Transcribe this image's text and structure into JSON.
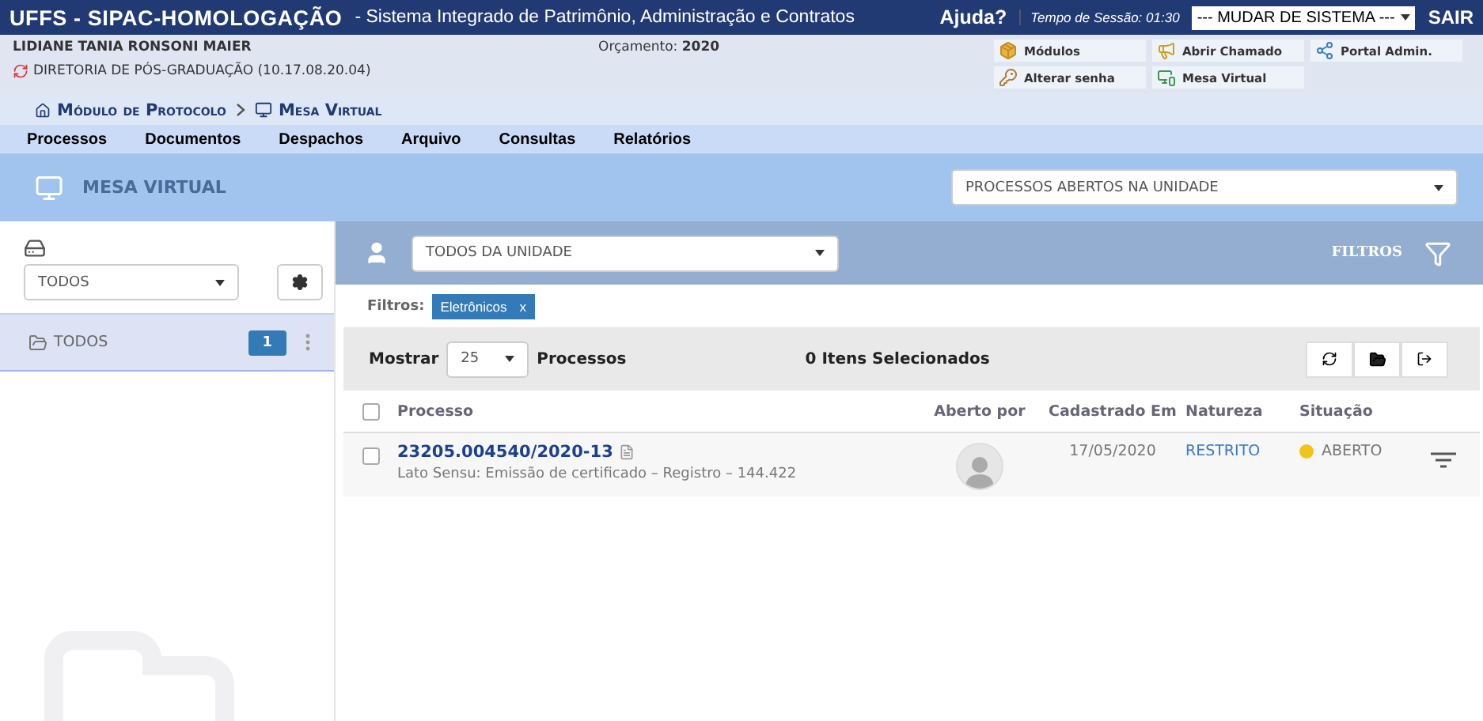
{
  "header": {
    "brand": "UFFS - SIPAC-HOMOLOGAÇÃO",
    "subtitle": "- Sistema Integrado de Patrimônio, Administração e Contratos",
    "help": "Ajuda?",
    "session_label": "Tempo de Sessão:",
    "session_time": "01:30",
    "system_select": "--- MUDAR DE SISTEMA ---",
    "logout": "SAIR"
  },
  "user": {
    "name": "LIDIANE TANIA RONSONI MAIER",
    "unit": "DIRETORIA DE PÓS-GRADUAÇÃO (10.17.08.20.04)",
    "budget_label": "Orçamento:",
    "budget_year": "2020"
  },
  "shortcuts": [
    {
      "label": "Módulos",
      "kind": "box"
    },
    {
      "label": "Abrir Chamado",
      "kind": "call"
    },
    {
      "label": "Portal Admin.",
      "kind": "portal"
    },
    {
      "label": "Alterar senha",
      "kind": "password"
    },
    {
      "label": "Mesa Virtual",
      "kind": "desk"
    }
  ],
  "breadcrumb": [
    {
      "label": "Módulo de Protocolo",
      "kind": "home"
    },
    {
      "label": "Mesa Virtual",
      "kind": "monitor"
    }
  ],
  "menu": [
    "Processos",
    "Documentos",
    "Despachos",
    "Arquivo",
    "Consultas",
    "Relatórios"
  ],
  "page_title": "MESA VIRTUAL",
  "view_select": "PROCESSOS ABERTOS NA UNIDADE",
  "sidebar": {
    "folder_select": "TODOS",
    "folders": [
      {
        "label": "TODOS",
        "count": "1",
        "selected": true
      }
    ]
  },
  "toolbar": {
    "user_select": "TODOS DA UNIDADE",
    "filters_label": "FILTROS"
  },
  "filters": {
    "label": "Filtros:",
    "tags": [
      {
        "label": "Eletrônicos",
        "remove": "x"
      }
    ]
  },
  "list_bar": {
    "show_label": "Mostrar",
    "page_size": "25",
    "unit": "Processos",
    "selected_count": "0 Itens Selecionados"
  },
  "table": {
    "all_checked": false,
    "columns": [
      "Processo",
      "Aberto por",
      "Cadastrado Em",
      "Natureza",
      "Situação"
    ],
    "rows": [
      {
        "checked": false,
        "number": "23205.004540/2020-13",
        "description": "Lato Sensu: Emissão de certificado – Registro – 144.422",
        "date": "17/05/2020",
        "nature": "RESTRITO",
        "status": "ABERTO",
        "color": "#f0c419"
      }
    ]
  }
}
